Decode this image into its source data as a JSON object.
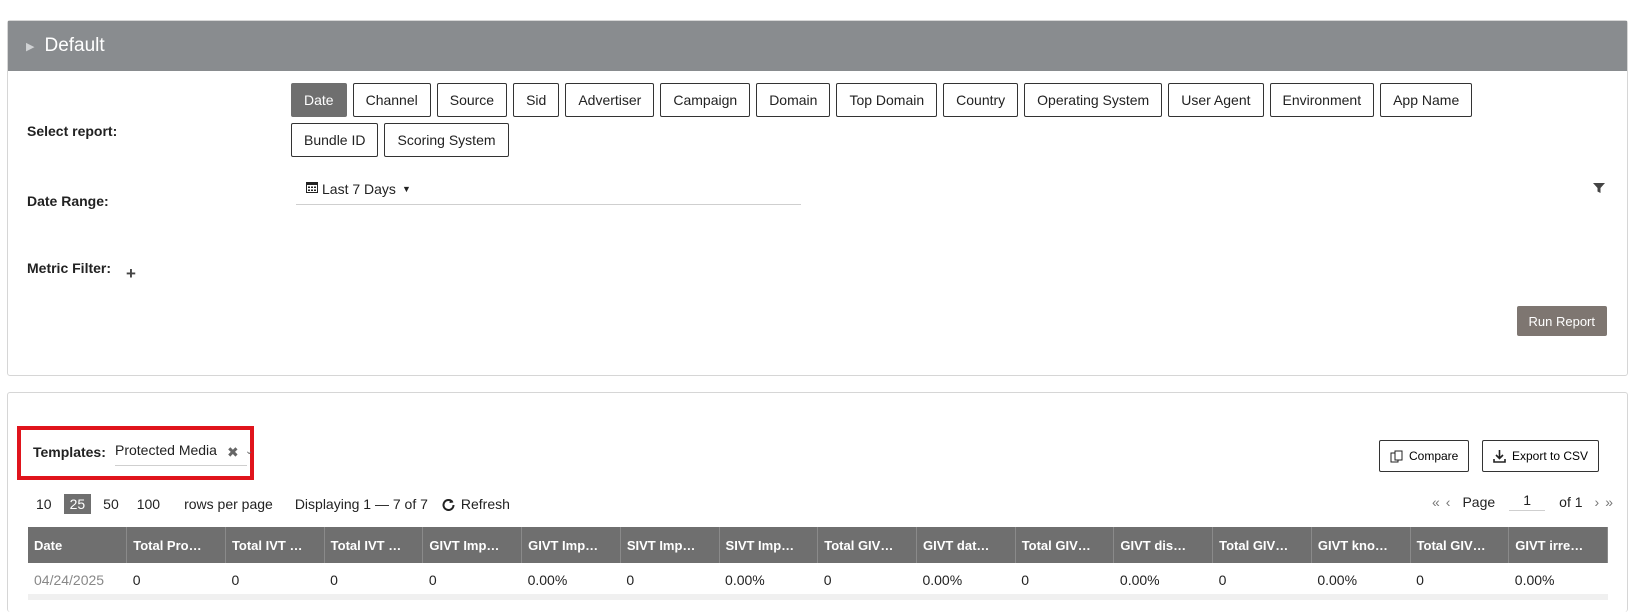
{
  "header": {
    "title": "Default"
  },
  "filters": {
    "select_report_label": "Select report:",
    "report_buttons": [
      {
        "label": "Date",
        "active": true
      },
      {
        "label": "Channel",
        "active": false
      },
      {
        "label": "Source",
        "active": false
      },
      {
        "label": "Sid",
        "active": false
      },
      {
        "label": "Advertiser",
        "active": false
      },
      {
        "label": "Campaign",
        "active": false
      },
      {
        "label": "Domain",
        "active": false
      },
      {
        "label": "Top Domain",
        "active": false
      },
      {
        "label": "Country",
        "active": false
      },
      {
        "label": "Operating System",
        "active": false
      },
      {
        "label": "User Agent",
        "active": false
      },
      {
        "label": "Environment",
        "active": false
      },
      {
        "label": "App Name",
        "active": false
      },
      {
        "label": "Bundle ID",
        "active": false
      },
      {
        "label": "Scoring System",
        "active": false
      }
    ],
    "date_range_label": "Date Range:",
    "date_range_value": "Last 7 Days",
    "metric_filter_label": "Metric Filter:",
    "run_report_label": "Run Report"
  },
  "results": {
    "templates_label": "Templates:",
    "template_value": "Protected Media",
    "compare_label": "Compare",
    "export_label": "Export to CSV",
    "page_sizes": [
      {
        "label": "10",
        "active": false
      },
      {
        "label": "25",
        "active": true
      },
      {
        "label": "50",
        "active": false
      },
      {
        "label": "100",
        "active": false
      }
    ],
    "rows_per_page_label": "rows per page",
    "displaying_text": "Displaying 1 — 7 of 7",
    "refresh_label": "Refresh",
    "page_label": "Page",
    "page_number": "1",
    "page_of": "of 1",
    "columns": [
      "Date",
      "Total Pro…",
      "Total IVT …",
      "Total IVT …",
      "GIVT Imp…",
      "GIVT Imp…",
      "SIVT Imp…",
      "SIVT Imp…",
      "Total GIV…",
      "GIVT dat…",
      "Total GIV…",
      "GIVT dis…",
      "Total GIV…",
      "GIVT kno…",
      "Total GIV…",
      "GIVT irre…"
    ],
    "rows": [
      [
        "04/24/2025",
        "0",
        "0",
        "0",
        "0",
        "0.00%",
        "0",
        "0.00%",
        "0",
        "0.00%",
        "0",
        "0.00%",
        "0",
        "0.00%",
        "0",
        "0.00%"
      ]
    ]
  },
  "colors": {
    "header_bg": "#898c8f",
    "active_btn": "#6f6f6f",
    "run_btn": "#7e7671",
    "highlight": "#e0141c"
  },
  "icons": [
    "caret-right-icon",
    "calendar-icon",
    "dropdown-caret-icon",
    "filter-icon",
    "plus-icon",
    "clear-icon",
    "chevron-down-icon",
    "compare-icon",
    "download-icon",
    "refresh-icon",
    "first-page-icon",
    "prev-page-icon",
    "next-page-icon",
    "last-page-icon"
  ]
}
